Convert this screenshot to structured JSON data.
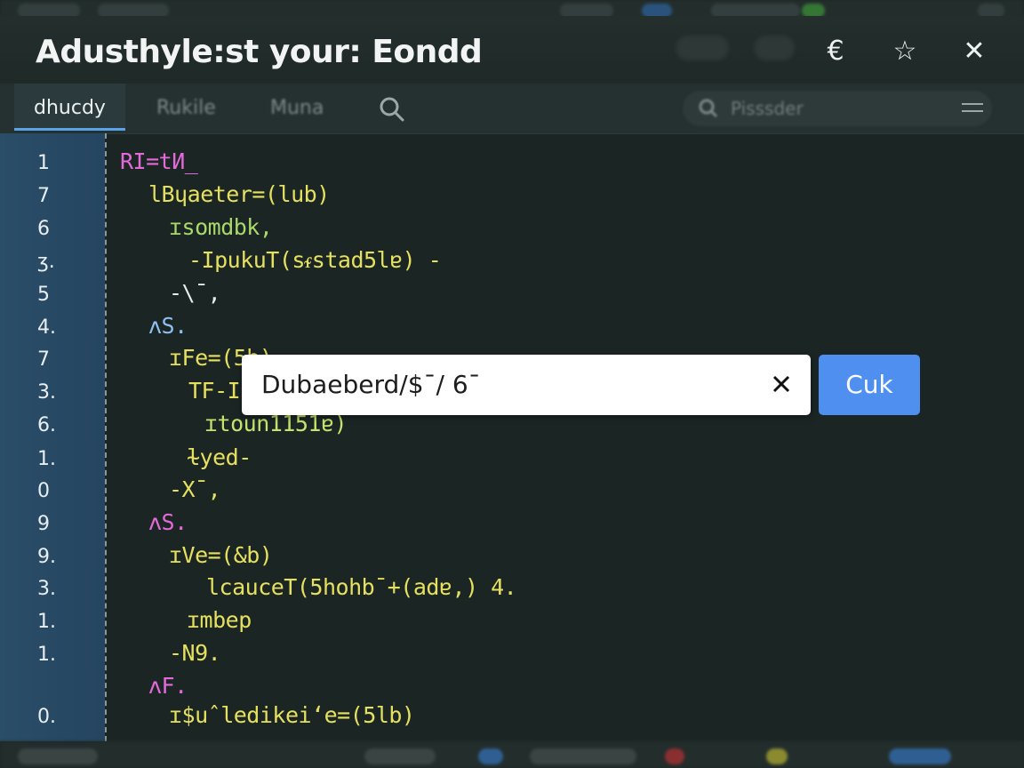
{
  "window": {
    "title": "Adusthyle:st your:  Eondd",
    "back_glyph": "€",
    "star_glyph": "☆",
    "close_glyph": "✕"
  },
  "tabs": [
    {
      "label": "dhucdy",
      "active": true
    },
    {
      "label": "Rukile",
      "active": false
    },
    {
      "label": "Muna",
      "active": false
    }
  ],
  "search": {
    "placeholder": "Pisssder"
  },
  "gutter": {
    "line_numbers": [
      "1",
      "7",
      "6",
      "ʒ.",
      "5",
      "4.",
      "7",
      "3.",
      "6.",
      "1.",
      "0",
      "9",
      "9.",
      "3.",
      "1.",
      "1.",
      "",
      "0."
    ]
  },
  "code": [
    {
      "text": "RI=tИ_",
      "color": "pink"
    },
    {
      "text": "lBɥaeter=(lub)",
      "color": "yellow"
    },
    {
      "text": "ɪsomdbk,",
      "color": "green"
    },
    {
      "text": "-IpukuT(sᵳstad5lɐ) -",
      "color": "yellow"
    },
    {
      "text": "-\\ˉ,",
      "color": "white"
    },
    {
      "text": "ʌS.",
      "color": "blue"
    },
    {
      "text": "ɪFe=(5b)",
      "color": "yellow"
    },
    {
      "text": "TF-I",
      "color": "yellow"
    },
    {
      "text": "ɪtoun1151ɐ)",
      "color": "lime"
    },
    {
      "text": "ɫyed-",
      "color": "yellow"
    },
    {
      "text": "-Xˉ,",
      "color": "yellow"
    },
    {
      "text": "ʌS.",
      "color": "pink"
    },
    {
      "text": "ɪVe=(&b)",
      "color": "yellow"
    },
    {
      "text": "lcauceT(5hohbˉ+(adɐ,) 4.",
      "color": "yellow"
    },
    {
      "text": "ɪmbep",
      "color": "yellow"
    },
    {
      "text": "-Ν9.",
      "color": "yellow"
    },
    {
      "text": "ʌF.",
      "color": "pink"
    },
    {
      "text": "ɪ$uˆledikeiʻe=(5lb)",
      "color": "yellow"
    }
  ],
  "find": {
    "value": "Dubaeberd/$ˉ/ 6ˉ",
    "button_label": "Cuk"
  },
  "colors": {
    "accent": "#4e8ff0",
    "gutter": "#2a4d68",
    "editor_bg": "#1b2624"
  }
}
